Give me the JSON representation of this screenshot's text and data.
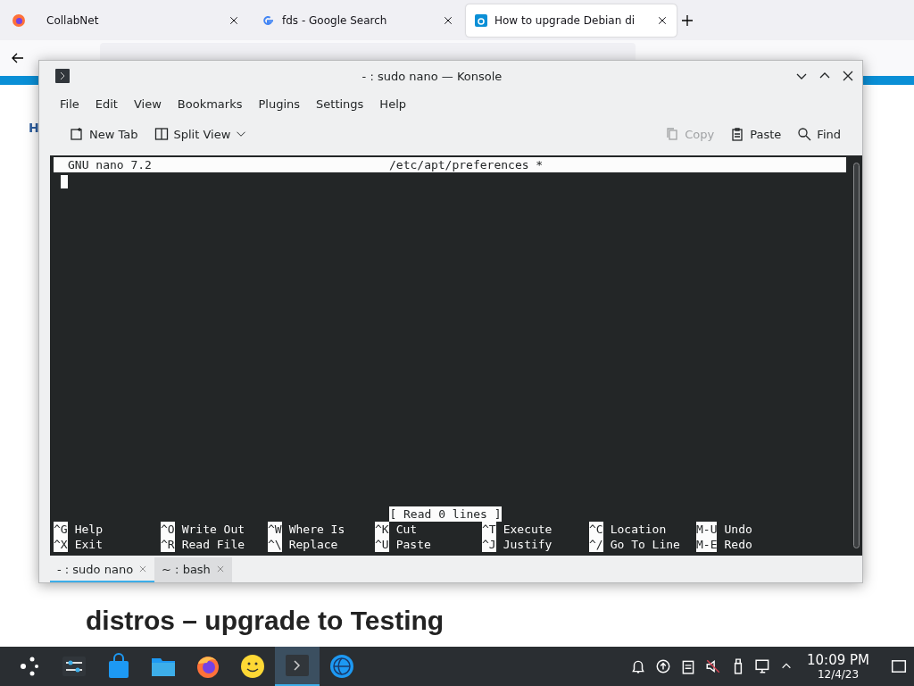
{
  "browser": {
    "tabs": [
      {
        "title": "CollabNet",
        "kind": "plain",
        "selected": false
      },
      {
        "title": "fds - Google Search",
        "kind": "google",
        "selected": false
      },
      {
        "title": "How to upgrade Debian di",
        "kind": "site",
        "selected": true
      }
    ],
    "page": {
      "link_fragment": "H",
      "heading_tail": "distros – upgrade to Testing"
    }
  },
  "konsole": {
    "title": "- : sudo nano — Konsole",
    "menu": [
      "File",
      "Edit",
      "View",
      "Bookmarks",
      "Plugins",
      "Settings",
      "Help"
    ],
    "toolbar_left": [
      {
        "label": "New Tab",
        "kind": "newtab"
      },
      {
        "label": "Split View",
        "kind": "split"
      }
    ],
    "toolbar_right": [
      {
        "label": "Copy",
        "kind": "copy",
        "disabled": true
      },
      {
        "label": "Paste",
        "kind": "paste",
        "disabled": false
      },
      {
        "label": "Find",
        "kind": "find",
        "disabled": false
      }
    ],
    "nano": {
      "version": "GNU nano 7.2",
      "file": "/etc/apt/preferences *",
      "status": "[ Read 0 lines ]",
      "shortcuts": [
        [
          {
            "key": "^G",
            "label": "Help"
          },
          {
            "key": "^O",
            "label": "Write Out"
          },
          {
            "key": "^W",
            "label": "Where Is"
          },
          {
            "key": "^K",
            "label": "Cut"
          },
          {
            "key": "^T",
            "label": "Execute"
          },
          {
            "key": "^C",
            "label": "Location"
          },
          {
            "key": "M-U",
            "label": "Undo"
          }
        ],
        [
          {
            "key": "^X",
            "label": "Exit"
          },
          {
            "key": "^R",
            "label": "Read File"
          },
          {
            "key": "^\\",
            "label": "Replace"
          },
          {
            "key": "^U",
            "label": "Paste"
          },
          {
            "key": "^J",
            "label": "Justify"
          },
          {
            "key": "^/",
            "label": "Go To Line"
          },
          {
            "key": "M-E",
            "label": "Redo"
          }
        ]
      ]
    },
    "session_tabs": [
      {
        "label": "- : sudo nano",
        "selected": true
      },
      {
        "label": "~ : bash",
        "selected": false
      }
    ]
  },
  "taskbar": {
    "apps": [
      {
        "kind": "settings",
        "selected": false
      },
      {
        "kind": "store",
        "selected": false
      },
      {
        "kind": "folder",
        "selected": false
      },
      {
        "kind": "firefox",
        "selected": false
      },
      {
        "kind": "smiley",
        "selected": false
      },
      {
        "kind": "terminal",
        "selected": true
      },
      {
        "kind": "globe",
        "selected": false
      }
    ],
    "time": "10:09 PM",
    "date": "12/4/23"
  }
}
